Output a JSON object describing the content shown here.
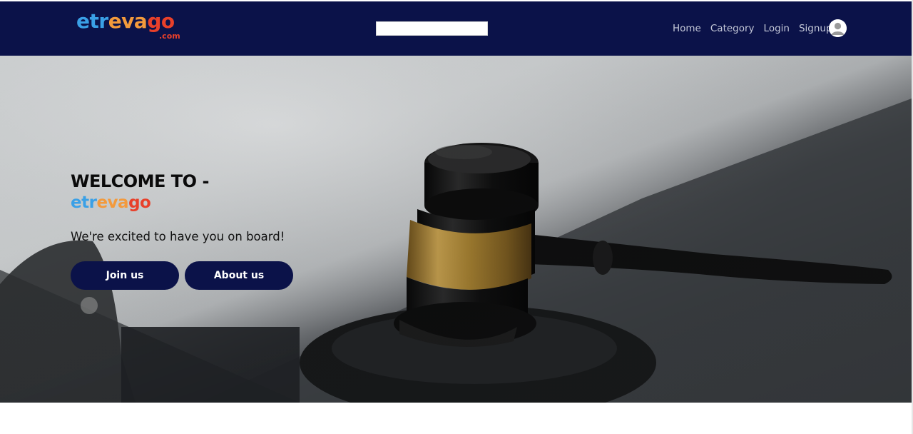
{
  "header": {
    "logo": {
      "parts": [
        {
          "text": "etr",
          "color": "#3aa0e6"
        },
        {
          "text": "eva",
          "color": "#f39a3c"
        },
        {
          "text": "go",
          "color": "#e8402a"
        }
      ],
      "suffix": ".com"
    },
    "search": {
      "value": "",
      "placeholder": ""
    },
    "nav": [
      {
        "label": "Home"
      },
      {
        "label": "Category"
      },
      {
        "label": "Login"
      },
      {
        "label": "Signup"
      }
    ],
    "avatar_icon": "user-avatar-icon",
    "background_color": "#0b1249"
  },
  "hero": {
    "title": "WELCOME TO -",
    "brand_parts": [
      {
        "text": "etr",
        "color": "#3aa0e6"
      },
      {
        "text": "eva",
        "color": "#f39a3c"
      },
      {
        "text": "go",
        "color": "#e8402a"
      }
    ],
    "subtitle": "We're excited to have you on board!",
    "buttons": {
      "join": "Join us",
      "about": "About us"
    },
    "image_subject": "judge-gavel"
  }
}
